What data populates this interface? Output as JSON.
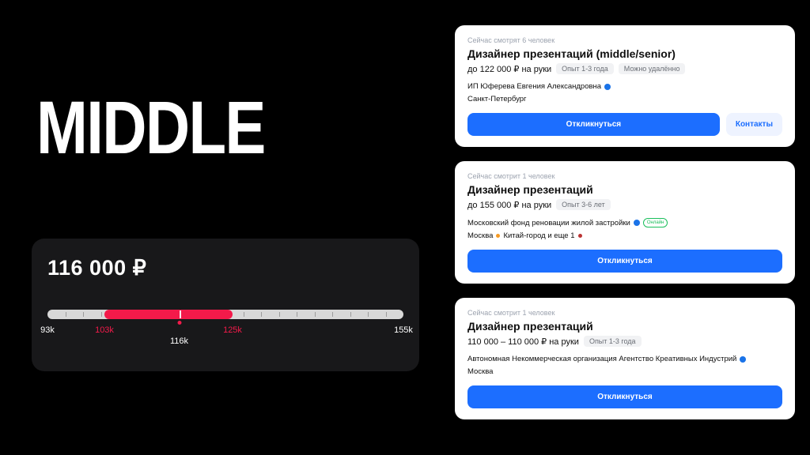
{
  "title": "MIDDLE",
  "salary_box": {
    "amount": "116 000 ₽",
    "min_label": "93k",
    "low_label": "103k",
    "high_label": "125k",
    "max_label": "155k",
    "mid_label": "116k",
    "fill_left_pct": 16,
    "fill_right_pct": 52,
    "handle_pct": 37,
    "min_pct": 0,
    "low_pct": 16,
    "mid_pct": 37,
    "high_pct": 52,
    "max_pct": 100
  },
  "cards": [
    {
      "viewers": "Сейчас смотрят 6 человек",
      "role": "Дизайнер презентаций (middle/senior)",
      "salary": "до 122 000 ₽ на руки",
      "pills": [
        "Опыт 1-3 года",
        "Можно удалённо"
      ],
      "company": "ИП Юферева Евгения Александровна",
      "verified": true,
      "online_badge": "",
      "location": "Санкт-Петербург",
      "metro": "",
      "primary_btn": "Откликнуться",
      "secondary_btn": "Контакты"
    },
    {
      "viewers": "Сейчас смотрит 1 человек",
      "role": "Дизайнер презентаций",
      "salary": "до 155 000 ₽ на руки",
      "pills": [
        "Опыт 3-6 лет"
      ],
      "company": "Московский фонд реновации жилой застройки",
      "verified": true,
      "online_badge": "Онлайн",
      "location": "Москва",
      "metro": "Китай-город и еще 1",
      "metro_color": "#f59a23",
      "primary_btn": "Откликнуться",
      "secondary_btn": ""
    },
    {
      "viewers": "Сейчас смотрит 1 человек",
      "role": "Дизайнер презентаций",
      "salary": "110 000 – 110 000 ₽ на руки",
      "pills": [
        "Опыт 1-3 года"
      ],
      "company": "Автономная Некоммерческая организация Агентство Креативных Индустрий",
      "verified": true,
      "online_badge": "",
      "location": "Москва",
      "metro": "",
      "primary_btn": "Откликнуться",
      "secondary_btn": ""
    }
  ]
}
